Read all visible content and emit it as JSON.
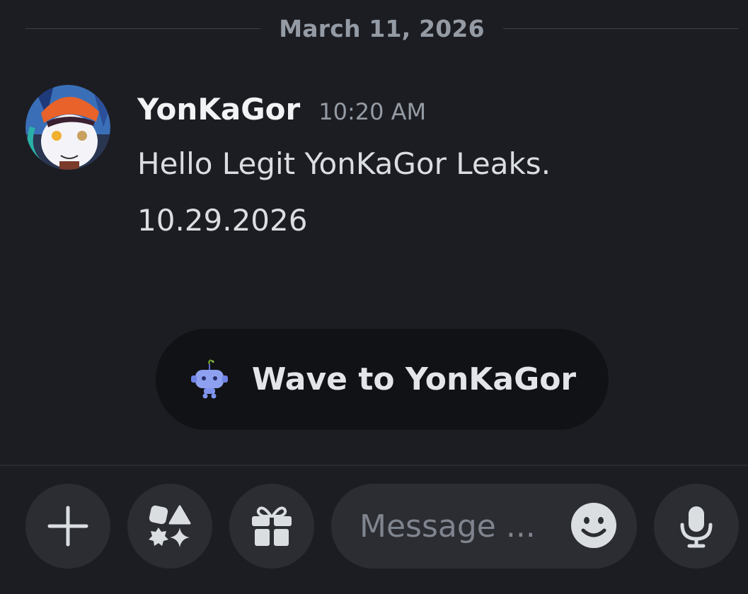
{
  "date_divider": {
    "label": "March 11, 2026"
  },
  "message": {
    "author": "YonKaGor",
    "timestamp": "10:20 AM",
    "lines": [
      "Hello Legit YonKaGor Leaks.",
      "10.29.2026"
    ]
  },
  "wave": {
    "label": "Wave to YonKaGor"
  },
  "composer": {
    "placeholder": "Message ...",
    "value": ""
  },
  "icons": {
    "add": "plus-icon",
    "apps": "apps-shapes-icon",
    "gift": "gift-icon",
    "emoji": "emoji-smile-icon",
    "voice": "microphone-icon",
    "wave_sticker": "wumpus-robot-icon"
  },
  "colors": {
    "background": "#1c1d22",
    "button_bg": "#2b2d33",
    "wave_bg": "#111215",
    "text_primary": "#f2f3f5",
    "text_muted": "#949ba4"
  }
}
